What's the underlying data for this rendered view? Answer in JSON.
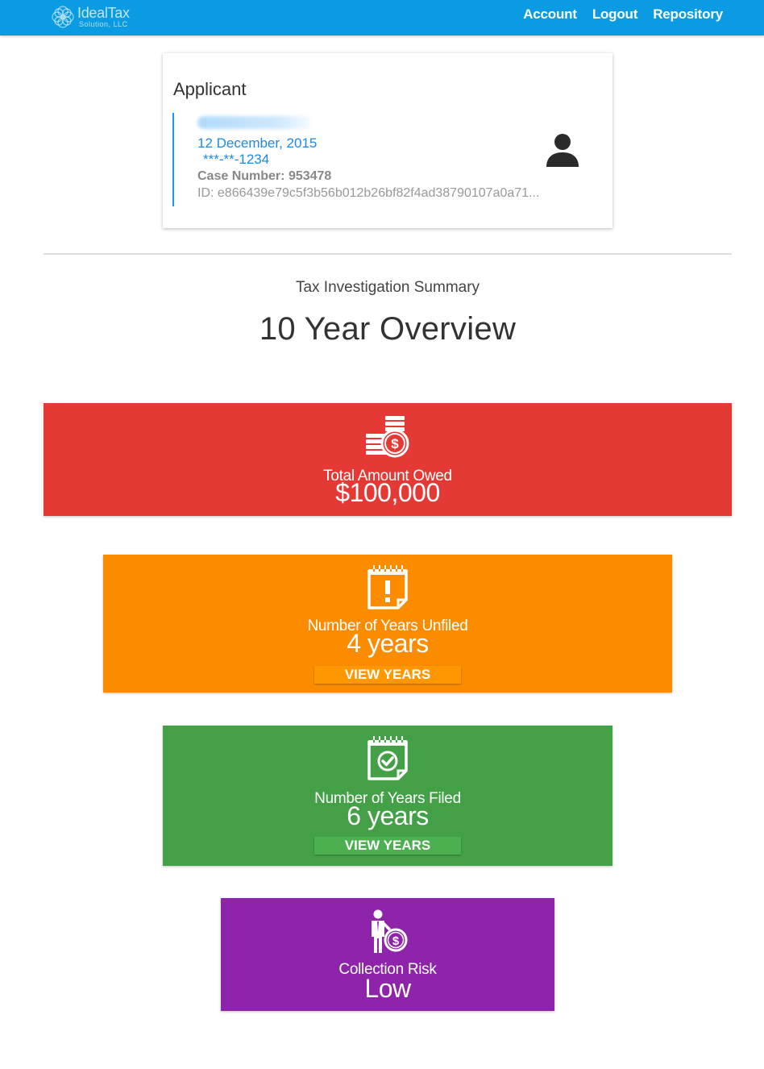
{
  "nav": {
    "logo_name": "IdealTax",
    "logo_sub": "Solution, LLC",
    "links": [
      "Account",
      "Logout",
      "Repository"
    ]
  },
  "applicant": {
    "heading": "Applicant",
    "date": "12 December, 2015",
    "ssn": "***-**-1234",
    "case_label": "Case Number:",
    "case_number": "953478",
    "id": "ID: e866439e79c5f3b56b012b26bf82f4ad38790107a0a71..."
  },
  "summary": {
    "subtitle": "Tax Investigation Summary",
    "title": "10 Year Overview"
  },
  "tiles": {
    "owed": {
      "label": "Total Amount Owed",
      "value": "$100,000",
      "color": "#e53935",
      "icon": "coins-dollar-icon"
    },
    "unfiled": {
      "label": "Number of Years Unfiled",
      "value": "4 years",
      "button": "VIEW YEARS",
      "color": "#fb8c00",
      "icon": "calendar-alert-icon"
    },
    "filed": {
      "label": "Number of Years Filed",
      "value": "6 years",
      "button": "VIEW YEARS",
      "color": "#43a047",
      "icon": "calendar-check-icon"
    },
    "risk": {
      "label": "Collection Risk",
      "value": "Low",
      "color": "#8e24aa",
      "icon": "businessman-dollar-icon"
    }
  },
  "colors": {
    "navbar": "#0a9be3",
    "accent": "#1e88e5"
  }
}
